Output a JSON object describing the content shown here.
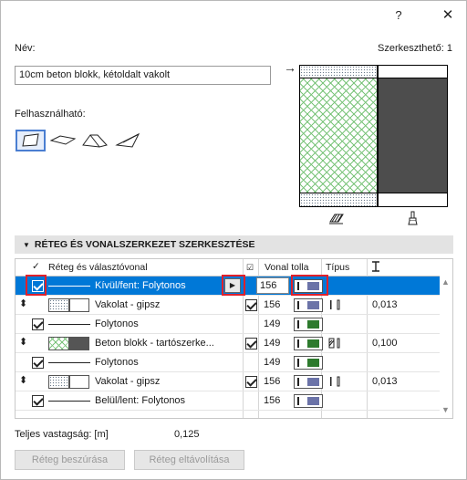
{
  "window": {
    "help_glyph": "?",
    "close_glyph": "✕"
  },
  "name_label": "Név:",
  "editable_label": "Szerkeszthető: 1",
  "name_value": "10cm beton blokk, kétoldalt vakolt",
  "usage_label": "Felhasználható:",
  "usage_icons": [
    "wall-icon",
    "slab-icon",
    "roof-icon",
    "shell-icon"
  ],
  "preview_arrow": "→",
  "section_title": "RÉTEG ÉS VONALSZERKEZET SZERKESZTÉSE",
  "table": {
    "headers": {
      "layer": "Réteg és választóvonal",
      "pen": "Vonal tolla",
      "type": "Típus"
    },
    "rows": [
      {
        "kind": "line",
        "checked": true,
        "label": "Kívül/fent: Folytonos",
        "pen": "156",
        "pen_fill": "#6b73a8",
        "selected": true
      },
      {
        "kind": "layer",
        "pattern": "dot",
        "label": "Vakolat - gipsz",
        "checked": true,
        "pen": "156",
        "pen_fill": "#6b73a8",
        "type": "skin",
        "thickness": "0,013"
      },
      {
        "kind": "line",
        "checked": true,
        "label": "Folytonos",
        "pen": "149",
        "pen_fill": "#2d7a2d"
      },
      {
        "kind": "layer",
        "pattern": "hatch",
        "label": "Beton blokk - tartószerke...",
        "checked": true,
        "pen": "149",
        "pen_fill": "#2d7a2d",
        "type": "core",
        "thickness": "0,100"
      },
      {
        "kind": "line",
        "checked": true,
        "label": "Folytonos",
        "pen": "149",
        "pen_fill": "#2d7a2d"
      },
      {
        "kind": "layer",
        "pattern": "dot",
        "label": "Vakolat - gipsz",
        "checked": true,
        "pen": "156",
        "pen_fill": "#6b73a8",
        "type": "skin",
        "thickness": "0,013"
      },
      {
        "kind": "line",
        "checked": true,
        "label": "Belül/lent: Folytonos",
        "pen": "156",
        "pen_fill": "#6b73a8"
      }
    ]
  },
  "total_label": "Teljes vastagság: [m]",
  "total_value": "0,125",
  "buttons": {
    "insert": "Réteg beszúrása",
    "remove": "Réteg eltávolítása"
  },
  "colors": {
    "selection": "#0078d7",
    "highlight": "#e0202a"
  }
}
